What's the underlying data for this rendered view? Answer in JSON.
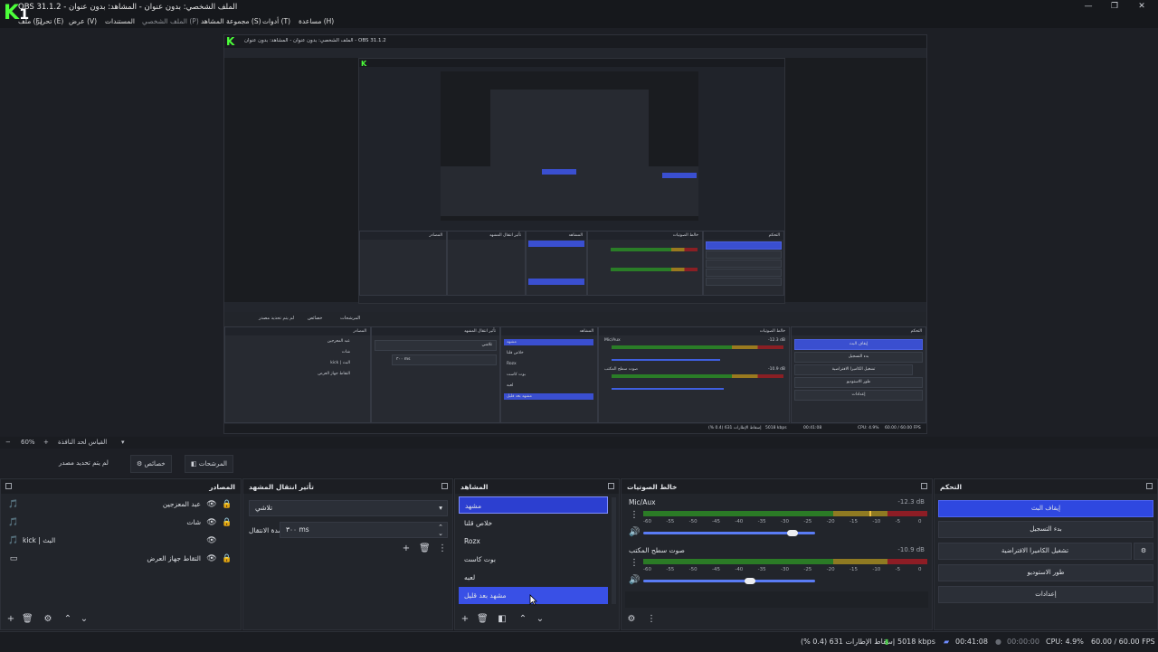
{
  "window": {
    "title": "OBS 31.1.2 - الملف الشخصي: بدون عنوان - المشاهد: بدون عنوان",
    "logo_text": "K",
    "logo_suffix": "1",
    "minimize": "—",
    "maximize": "❐",
    "close": "✕"
  },
  "menu": {
    "items": [
      "ملف (F)",
      "تحرير (E)",
      "عرض (V)",
      "المستندات",
      "الملف الشخصي (P)",
      "مجموعة المشاهد (S)",
      "أدوات (T)",
      "مساعدة (H)"
    ]
  },
  "preview": {
    "nested_title": "الملف الشخصي: بدون عنوان - المشاهد: بدون عنوان - OBS 31.1.2"
  },
  "preview_bar": {
    "zoom_minus": "−",
    "zoom": "60%",
    "zoom_plus": "+",
    "fit_label": "القياس لحد النافذة",
    "dropdown": "▾"
  },
  "toolbar": {
    "no_source": "لم يتم تحديد مصدر",
    "properties": "خصائص",
    "filters": "المرشحات"
  },
  "sources": {
    "title": "المصادر",
    "items": [
      {
        "label": "عبد المعزجين",
        "type": "🎵"
      },
      {
        "label": "شات",
        "type": "🎵"
      },
      {
        "label": "kick | البث",
        "type": "🎵"
      },
      {
        "label": "التقاط جهاز العرض",
        "type": "▭"
      }
    ]
  },
  "transitions": {
    "title": "تأثير انتقال المشهد",
    "selected": "تلاشي",
    "duration_label": "مدة الانتقال",
    "duration_value": "٣٠٠ ms"
  },
  "scenes": {
    "title": "المشاهد",
    "items": [
      "مشهد",
      "خلاص قلنا",
      "Rozx",
      "بوت كاست",
      "لعبه",
      "مشهد بعد قليل"
    ],
    "selected_index": 0,
    "highlight_index": 5
  },
  "mixer": {
    "title": "خالط الصوتيات",
    "channels": [
      {
        "name": "Mic/Aux",
        "db": "-12.3 dB",
        "level": 0.87
      },
      {
        "name": "صوت سطح المكتب",
        "db": "-10.9 dB",
        "level": 0.62
      }
    ],
    "scale": [
      "-60",
      "-55",
      "-50",
      "-45",
      "-40",
      "-35",
      "-30",
      "-25",
      "-20",
      "-15",
      "-10",
      "-5",
      "0"
    ]
  },
  "controls": {
    "title": "التحكم",
    "buttons": [
      "إيقاف البث",
      "بدء التسجيل",
      "تشغيل الكاميرا الافتراضية",
      "طور الاستوديو",
      "إعدادات"
    ]
  },
  "status": {
    "dropped": "إسقاط الإطارات 631 (0.4 %)",
    "bitrate": "5018 kbps",
    "live_time": "00:41:08",
    "rec_time": "00:00:00",
    "cpu": "CPU: 4.9%",
    "fps": "60.00 / 60.00 FPS"
  }
}
